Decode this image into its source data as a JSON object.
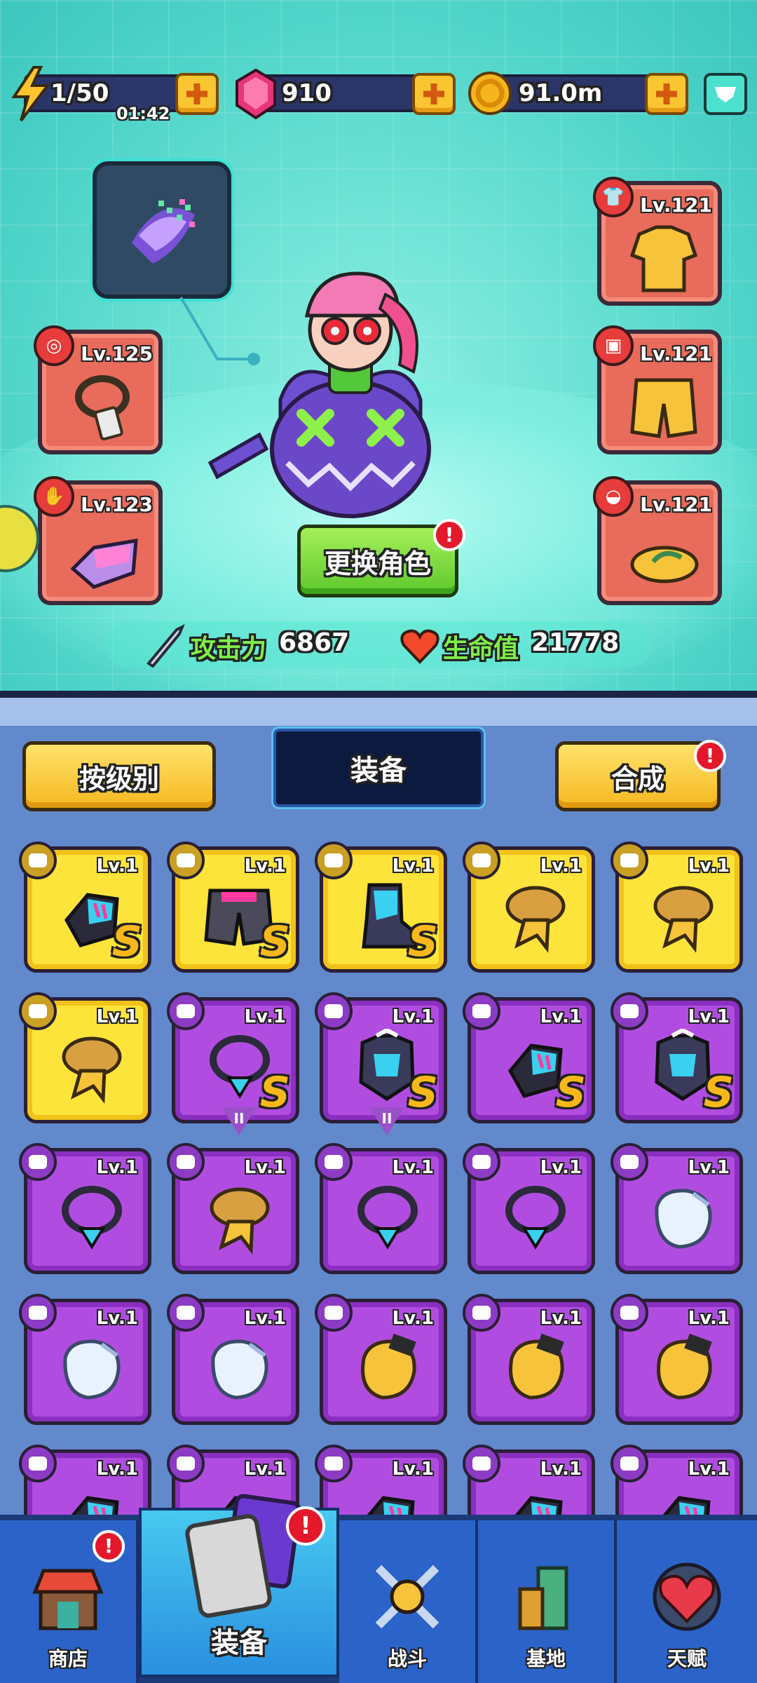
{
  "resources": {
    "energy": {
      "value": "1/50",
      "timer": "01:42",
      "icon": "lightning-icon"
    },
    "gems": {
      "value": "910",
      "icon": "pink-gem-icon"
    },
    "coins": {
      "value": "91.0m",
      "icon": "gold-coin-icon"
    }
  },
  "character": {
    "change_button": "更换角色",
    "attack_label": "攻击力",
    "attack_value": "6867",
    "hp_label": "生命值",
    "hp_value": "21778"
  },
  "equipped": {
    "left": [
      {
        "level": "Lv.125",
        "item": "necklace-tag"
      },
      {
        "level": "Lv.123",
        "item": "gauntlet"
      }
    ],
    "right": [
      {
        "level": "Lv.121",
        "item": "hawaiian-shirt"
      },
      {
        "level": "Lv.121",
        "item": "shorts"
      },
      {
        "level": "Lv.121",
        "item": "flip-flops"
      }
    ]
  },
  "inventory": {
    "sort_button": "按级别",
    "title": "装备",
    "merge_button": "合成",
    "items": [
      {
        "level": "Lv.1",
        "rarity": "gold",
        "item": "glove",
        "rank": "S"
      },
      {
        "level": "Lv.1",
        "rarity": "gold",
        "item": "shorts",
        "rank": "S"
      },
      {
        "level": "Lv.1",
        "rarity": "gold",
        "item": "boot",
        "rank": "S"
      },
      {
        "level": "Lv.1",
        "rarity": "gold",
        "item": "scarf",
        "rank": ""
      },
      {
        "level": "Lv.1",
        "rarity": "gold",
        "item": "scarf",
        "rank": ""
      },
      {
        "level": "Lv.1",
        "rarity": "gold",
        "item": "scarf",
        "rank": ""
      },
      {
        "level": "Lv.1",
        "rarity": "purple",
        "item": "necklace",
        "rank": "S"
      },
      {
        "level": "Lv.1",
        "rarity": "purple",
        "item": "armor",
        "rank": "S"
      },
      {
        "level": "Lv.1",
        "rarity": "purple",
        "item": "glove",
        "rank": "S"
      },
      {
        "level": "Lv.1",
        "rarity": "purple",
        "item": "armor",
        "rank": "S"
      },
      {
        "level": "Lv.1",
        "rarity": "purple",
        "item": "necklace",
        "rank": ""
      },
      {
        "level": "Lv.1",
        "rarity": "purple",
        "item": "scarf",
        "rank": ""
      },
      {
        "level": "Lv.1",
        "rarity": "purple",
        "item": "necklace",
        "rank": ""
      },
      {
        "level": "Lv.1",
        "rarity": "purple",
        "item": "necklace",
        "rank": ""
      },
      {
        "level": "Lv.1",
        "rarity": "purple",
        "item": "mitten",
        "rank": ""
      },
      {
        "level": "Lv.1",
        "rarity": "purple",
        "item": "mitten",
        "rank": ""
      },
      {
        "level": "Lv.1",
        "rarity": "purple",
        "item": "mitten",
        "rank": ""
      },
      {
        "level": "Lv.1",
        "rarity": "purple",
        "item": "fist",
        "rank": ""
      },
      {
        "level": "Lv.1",
        "rarity": "purple",
        "item": "fist",
        "rank": ""
      },
      {
        "level": "Lv.1",
        "rarity": "purple",
        "item": "fist",
        "rank": ""
      },
      {
        "level": "Lv.1",
        "rarity": "purple",
        "item": "glove",
        "rank": ""
      },
      {
        "level": "Lv.1",
        "rarity": "purple",
        "item": "glove",
        "rank": ""
      },
      {
        "level": "Lv.1",
        "rarity": "purple",
        "item": "glove",
        "rank": ""
      },
      {
        "level": "Lv.1",
        "rarity": "purple",
        "item": "glove",
        "rank": ""
      },
      {
        "level": "Lv.1",
        "rarity": "purple",
        "item": "glove",
        "rank": ""
      }
    ]
  },
  "nav": {
    "shop": "商店",
    "equipment": "装备",
    "battle": "战斗",
    "base": "基地",
    "talent": "天赋"
  },
  "colors": {
    "gold_card": "#fde43a",
    "purple_card": "#b04de0",
    "slot_red": "#e86b5c",
    "accent_yellow": "#f9c531"
  }
}
